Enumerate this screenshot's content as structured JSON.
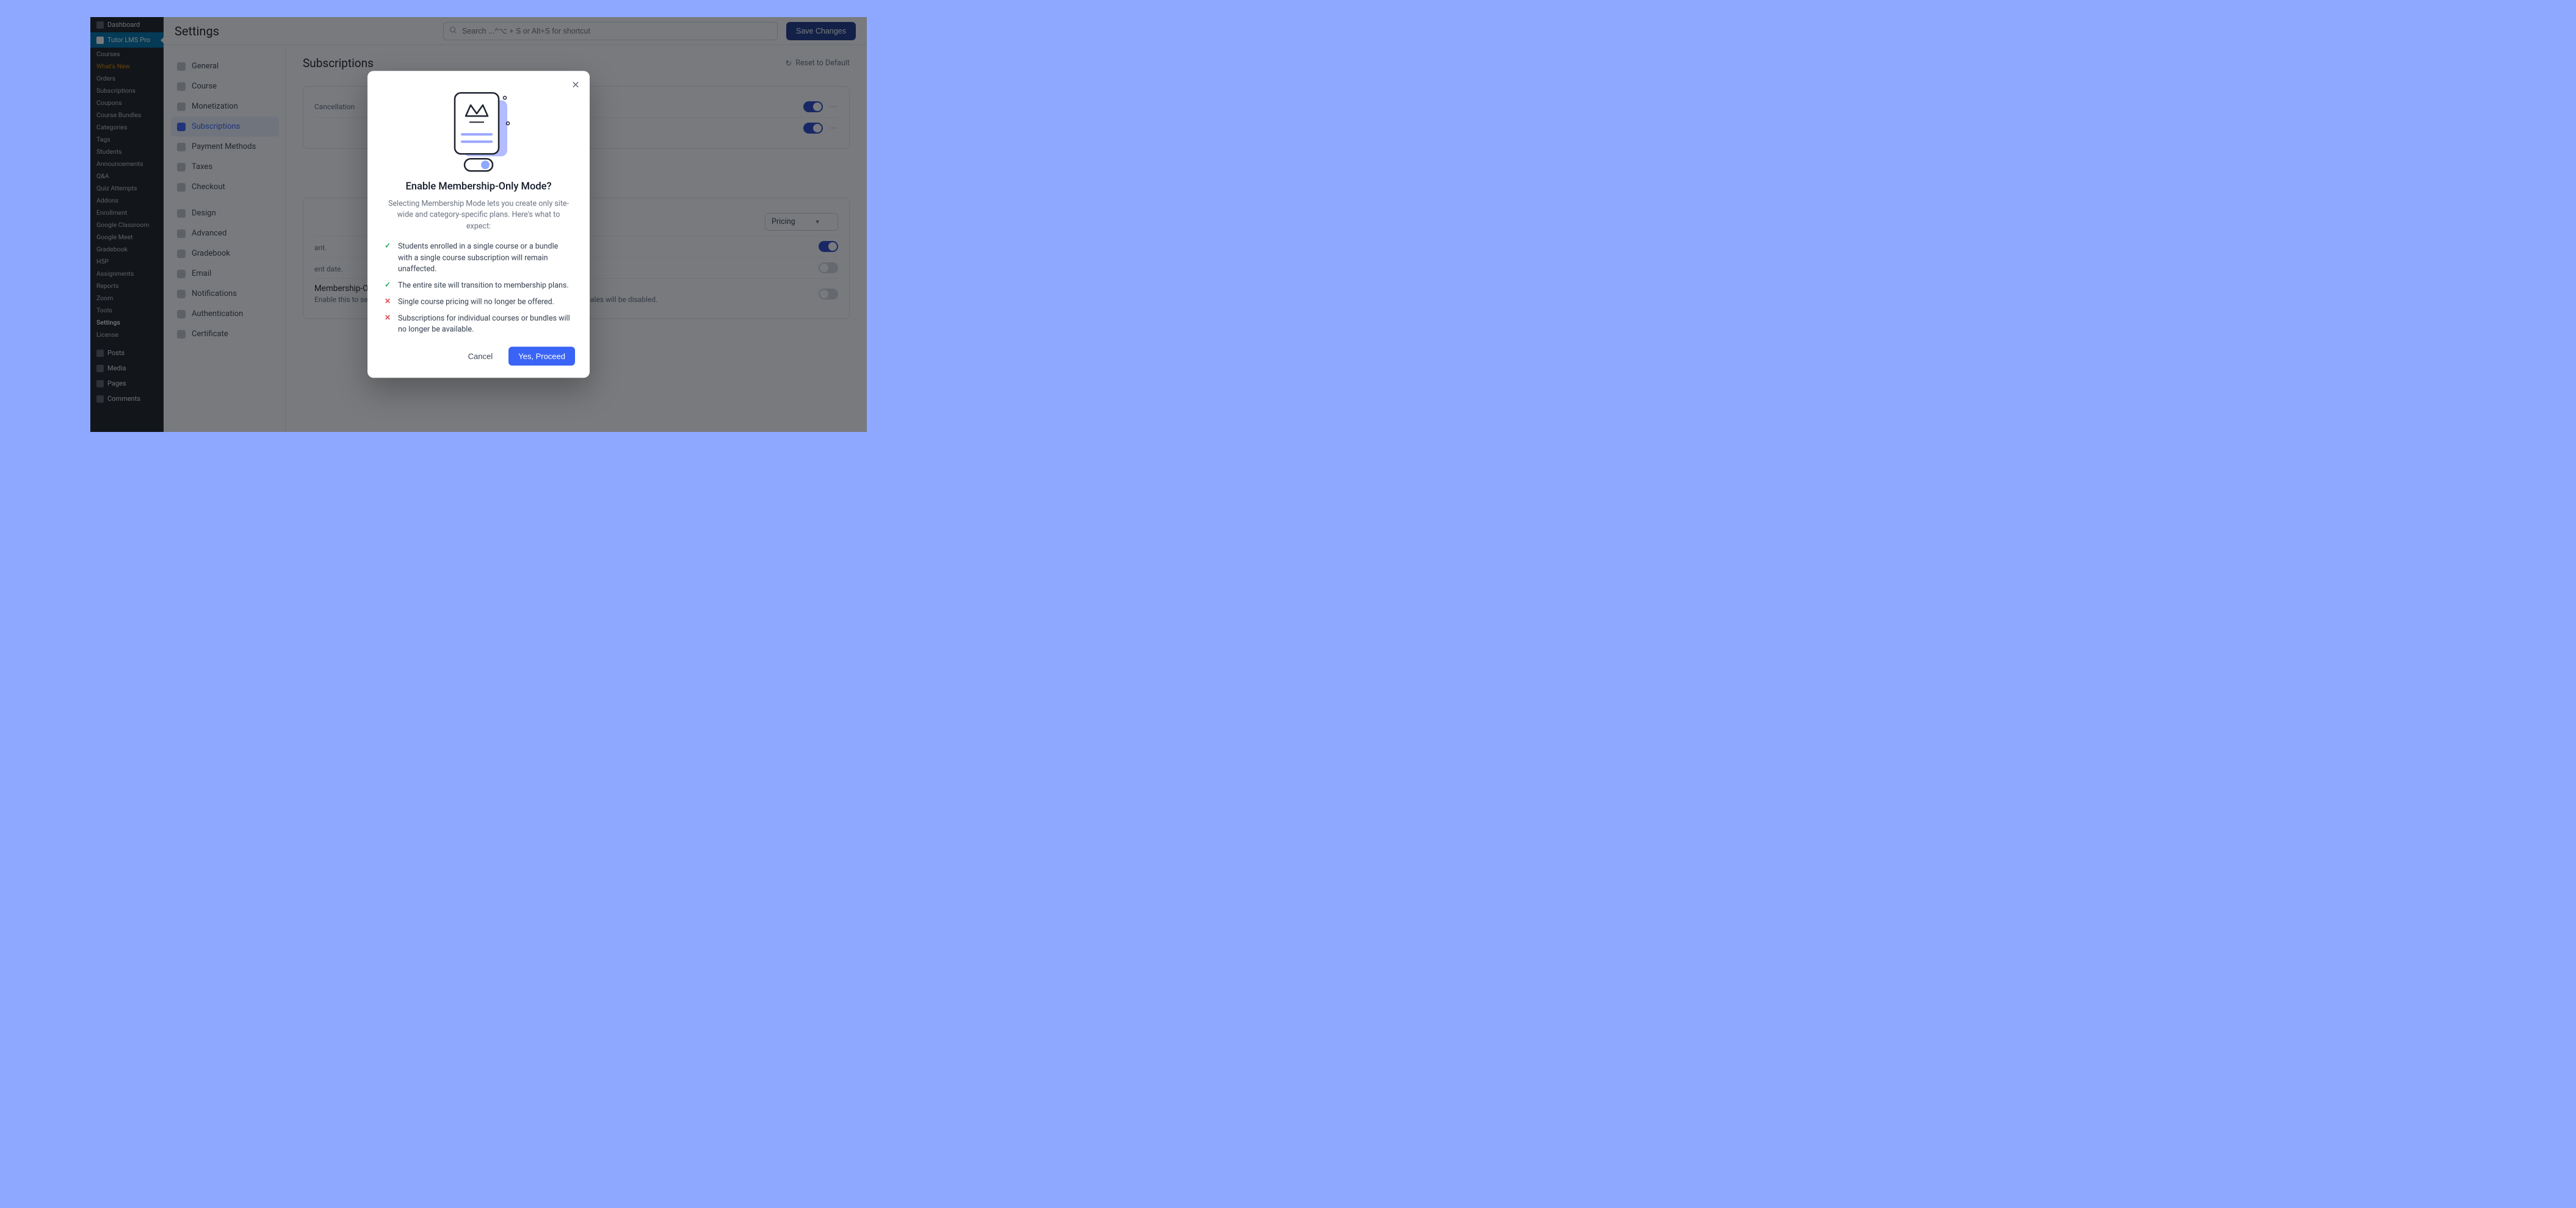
{
  "sidebar": {
    "top_dashboard": "Dashboard",
    "top_plugin": "Tutor LMS Pro",
    "items": [
      "Courses",
      "What's New",
      "Orders",
      "Subscriptions",
      "Coupons",
      "Course Bundles",
      "Categories",
      "Tags",
      "Students",
      "Announcements",
      "Q&A",
      "Quiz Attempts",
      "Addons",
      "Enrollment",
      "Google Classroom",
      "Google Meet",
      "Gradebook",
      "H5P",
      "Assignments",
      "Reports",
      "Zoom",
      "Tools",
      "Settings",
      "License"
    ],
    "bottom": [
      "Posts",
      "Media",
      "Pages",
      "Comments"
    ]
  },
  "header": {
    "title": "Settings",
    "search_placeholder": "Search ...^⌥ + S or Alt+S for shortcut",
    "save": "Save Changes"
  },
  "nav": [
    "General",
    "Course",
    "Monetization",
    "Subscriptions",
    "Payment Methods",
    "Taxes",
    "Checkout",
    "Design",
    "Advanced",
    "Gradebook",
    "Email",
    "Notifications",
    "Authentication",
    "Certificate"
  ],
  "nav_active_index": 3,
  "panel": {
    "title": "Subscriptions",
    "reset": "Reset to Default",
    "card1": {
      "row1_suffix": "Cancellation",
      "row2_label": ""
    },
    "section_tag": "",
    "card2": {
      "sort_header_label": "",
      "sort_value": "Pricing",
      "opt1_title": "",
      "opt1_desc_suffix": "ant.",
      "opt2_title": "",
      "opt2_desc_suffix": "ent date.",
      "opt3_title": "Membership-Only Mode",
      "opt3_desc": "Enable this to sell courses exclusively through membership plans. Individual course sales will be disabled."
    }
  },
  "modal": {
    "title": "Enable Membership-Only Mode?",
    "subtitle": "Selecting Membership Mode lets you create only site-wide and category-specific plans. Here's what to expect:",
    "items": [
      {
        "ok": true,
        "text": "Students enrolled in a single course or a bundle with a single course subscription will remain unaffected."
      },
      {
        "ok": true,
        "text": "The entire site will transition to membership plans."
      },
      {
        "ok": false,
        "text": "Single course pricing will no longer be offered."
      },
      {
        "ok": false,
        "text": "Subscriptions for individual courses or bundles will no longer be available."
      }
    ],
    "cancel": "Cancel",
    "confirm": "Yes, Proceed"
  }
}
